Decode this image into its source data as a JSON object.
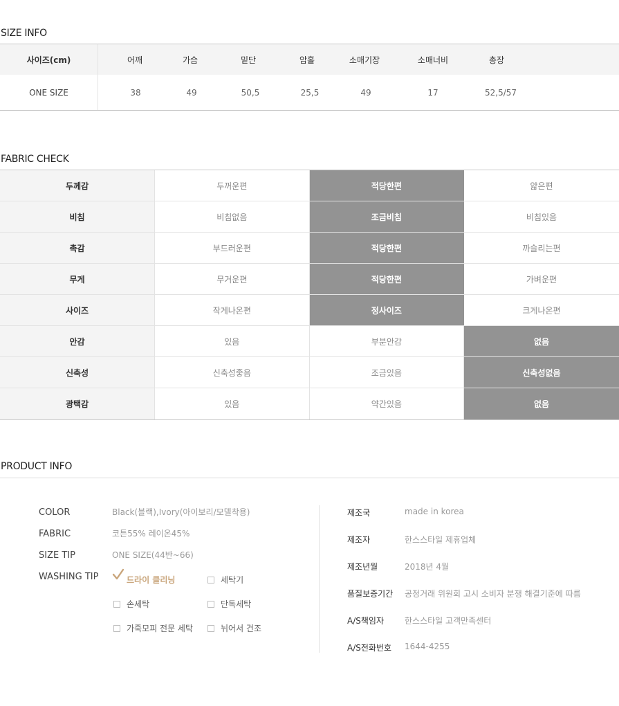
{
  "size_info": {
    "title": "SIZE INFO",
    "label_header": "사이즈(cm)",
    "columns": [
      "어깨",
      "가슴",
      "밑단",
      "암홀",
      "소매기장",
      "소매너비",
      "총장"
    ],
    "row_label": "ONE SIZE",
    "values": [
      "38",
      "49",
      "50,5",
      "25,5",
      "49",
      "17",
      "52,5/57"
    ]
  },
  "fabric_check": {
    "title": "FABRIC CHECK",
    "rows": [
      {
        "label": "두께감",
        "options": [
          "두꺼운편",
          "적당한편",
          "얇은편"
        ],
        "selected": 1
      },
      {
        "label": "비침",
        "options": [
          "비침없음",
          "조금비침",
          "비침있음"
        ],
        "selected": 1
      },
      {
        "label": "촉감",
        "options": [
          "부드러운편",
          "적당한편",
          "까슬리는편"
        ],
        "selected": 1
      },
      {
        "label": "무게",
        "options": [
          "무거운편",
          "적당한편",
          "가벼운편"
        ],
        "selected": 1
      },
      {
        "label": "사이즈",
        "options": [
          "작게나온편",
          "정사이즈",
          "크게나온편"
        ],
        "selected": 1
      },
      {
        "label": "안감",
        "options": [
          "있음",
          "부분안감",
          "없음"
        ],
        "selected": 2
      },
      {
        "label": "신축성",
        "options": [
          "신축성좋음",
          "조금있음",
          "신축성없음"
        ],
        "selected": 2
      },
      {
        "label": "광택감",
        "options": [
          "있음",
          "약간있음",
          "없음"
        ],
        "selected": 2
      }
    ]
  },
  "product_info": {
    "title": "PRODUCT INFO",
    "color_label": "COLOR",
    "color_value": "Black(블랙),Ivory(아이보리/모델착용)",
    "fabric_label": "FABRIC",
    "fabric_value": "코튼55% 레이온45%",
    "size_tip_label": "SIZE TIP",
    "size_tip_value": "ONE SIZE(44반~66)",
    "washing_tip_label": "WASHING TIP",
    "washing": [
      {
        "label": "드라이 클리닝",
        "checked": true
      },
      {
        "label": "세탁기",
        "checked": false
      },
      {
        "label": "손세탁",
        "checked": false
      },
      {
        "label": "단독세탁",
        "checked": false
      },
      {
        "label": "가죽모피 전문 세탁",
        "checked": false
      },
      {
        "label": "뉘어서 건조",
        "checked": false
      }
    ],
    "details": [
      {
        "key": "제조국",
        "value": "made in korea"
      },
      {
        "key": "제조자",
        "value": "한스스타일 제휴업체"
      },
      {
        "key": "제조년월",
        "value": "2018년 4월"
      },
      {
        "key": "품질보증기간",
        "value": "공정거래 위원회 고시 소비자 분쟁 해결기준에 따름"
      },
      {
        "key": "A/S책임자",
        "value": "한스스타일 고객만족센터"
      },
      {
        "key": "A/S전화번호",
        "value": "1644-4255"
      }
    ],
    "check_color": "#c9a57b"
  }
}
